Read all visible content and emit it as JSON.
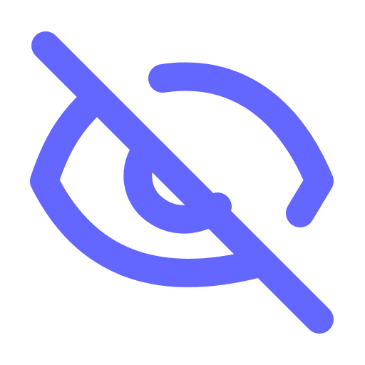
{
  "icon": {
    "name": "eye-off-icon",
    "color": "#6366ff",
    "background": "#ffffff"
  }
}
